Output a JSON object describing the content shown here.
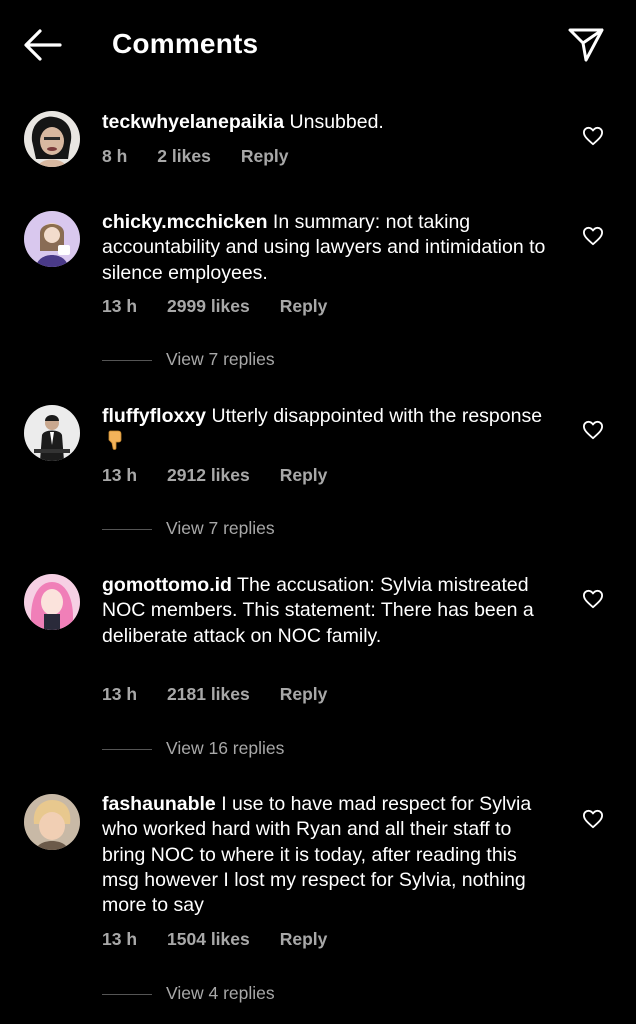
{
  "header": {
    "title": "Comments",
    "back_icon": "arrow-left-icon",
    "share_icon": "paper-plane-icon"
  },
  "comments": [
    {
      "username": "teckwhyelanepaikia",
      "text": "Unsubbed.",
      "time": "8 h",
      "likes": "2 likes",
      "reply": "Reply"
    },
    {
      "username": "chicky.mcchicken",
      "text": "In summary: not taking accountability and using lawyers and intimidation to silence employees.",
      "time": "13 h",
      "likes": "2999 likes",
      "reply": "Reply",
      "view_replies": "View 7 replies"
    },
    {
      "username": "fluffyfloxxy",
      "text": "Utterly disappointed with the response",
      "emoji": "thumbs-down-icon",
      "time": "13 h",
      "likes": "2912 likes",
      "reply": "Reply",
      "view_replies": "View 7 replies"
    },
    {
      "username": "gomottomo.id",
      "text": "The accusation: Sylvia mistreated NOC members. This statement: There has been a deliberate attack on NOC family.",
      "time": "13 h",
      "likes": "2181 likes",
      "reply": "Reply",
      "view_replies": "View 16 replies"
    },
    {
      "username": "fashaunable",
      "text": "I use to have mad respect for Sylvia who worked hard with Ryan and all their staff to bring NOC to where it is today, after reading this msg however I lost my respect for Sylvia, nothing more to say",
      "time": "13 h",
      "likes": "1504 likes",
      "reply": "Reply",
      "view_replies": "View 4 replies"
    }
  ],
  "colors": {
    "background": "#000000",
    "text": "#ffffff",
    "secondary": "#a8a8a8"
  }
}
